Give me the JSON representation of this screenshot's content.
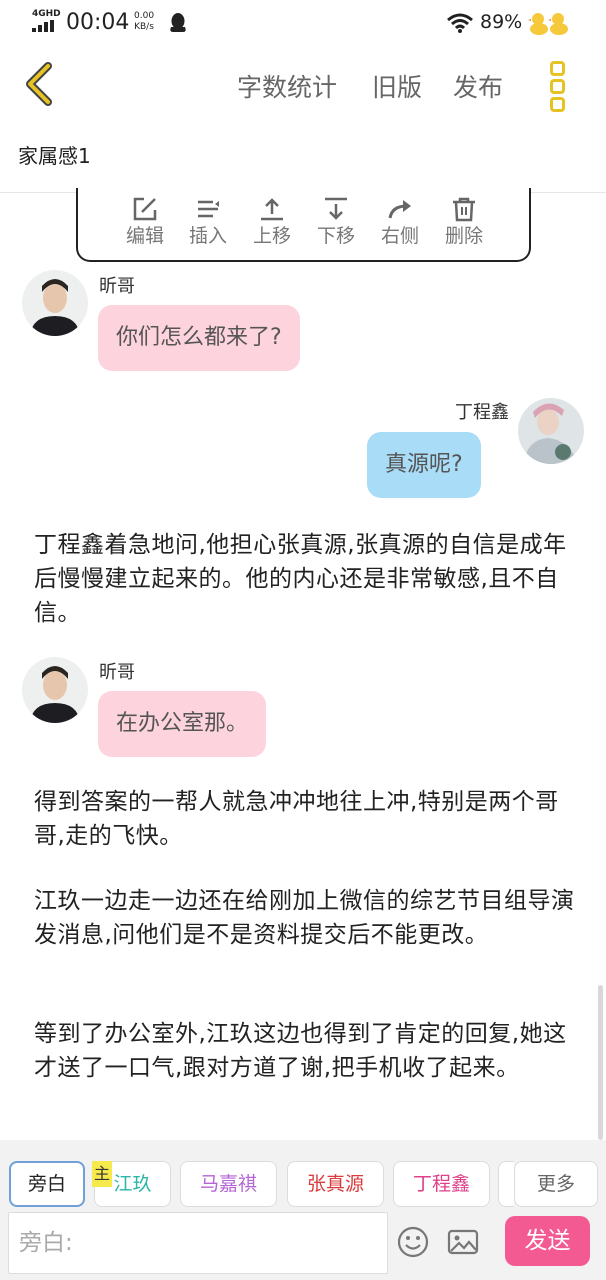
{
  "status_bar": {
    "network": "4GHD",
    "time": "00:04",
    "speed_value": "0.00",
    "speed_unit": "KB/s",
    "battery": "89%",
    "icons": [
      "signal-icon",
      "qq-icon",
      "wifi-icon",
      "duck-icon"
    ]
  },
  "header": {
    "back_icon": "chevron-left-icon",
    "word_count": "字数统计",
    "old_version": "旧版",
    "publish": "发布",
    "more_icon": "more-vertical-icon",
    "accent_color": "#e6c323"
  },
  "document": {
    "title": "家属感1"
  },
  "toolbar": {
    "items": [
      {
        "label": "编辑",
        "icon": "edit-icon"
      },
      {
        "label": "插入",
        "icon": "insert-icon"
      },
      {
        "label": "上移",
        "icon": "move-up-icon"
      },
      {
        "label": "下移",
        "icon": "move-down-icon"
      },
      {
        "label": "右侧",
        "icon": "redo-right-icon"
      },
      {
        "label": "删除",
        "icon": "trash-icon"
      }
    ]
  },
  "messages": [
    {
      "speaker": "昕哥",
      "text": "你们怎么都来了?",
      "side": "left"
    },
    {
      "speaker": "丁程鑫",
      "text": "真源呢?",
      "side": "right"
    },
    {
      "speaker": "昕哥",
      "text": "在办公室那。",
      "side": "left"
    }
  ],
  "narration": [
    "丁程鑫着急地问,他担心张真源,张真源的自信是成年后慢慢建立起来的。他的内心还是非常敏感,且不自信。",
    "得到答案的一帮人就急冲冲地往上冲,特别是两个哥哥,走的飞快。",
    "江玖一边走一边还在给刚加上微信的综艺节目组导演发消息,问他们是不是资料提交后不能更改。",
    "等到了办公室外,江玖这边也得到了肯定的回复,她这才送了一口气,跟对方道了谢,把手机收了起来。"
  ],
  "role_bar": {
    "chips": [
      {
        "label": "旁白",
        "color": "#888888",
        "selected": true
      },
      {
        "label": "江玖",
        "color": "#2bb6a8",
        "selected": false
      },
      {
        "label": "马嘉祺",
        "color": "#b565d6",
        "selected": false
      },
      {
        "label": "张真源",
        "color": "#d93c3c",
        "selected": false
      },
      {
        "label": "丁程鑫",
        "color": "#e0408a",
        "selected": false
      },
      {
        "label": "更多",
        "color": "#666666",
        "selected": false
      }
    ],
    "main_tag": "主"
  },
  "composer": {
    "placeholder": "旁白:",
    "emoji_icon": "emoji-icon",
    "image_icon": "image-icon",
    "send_label": "发送",
    "send_color": "#f45a92"
  }
}
